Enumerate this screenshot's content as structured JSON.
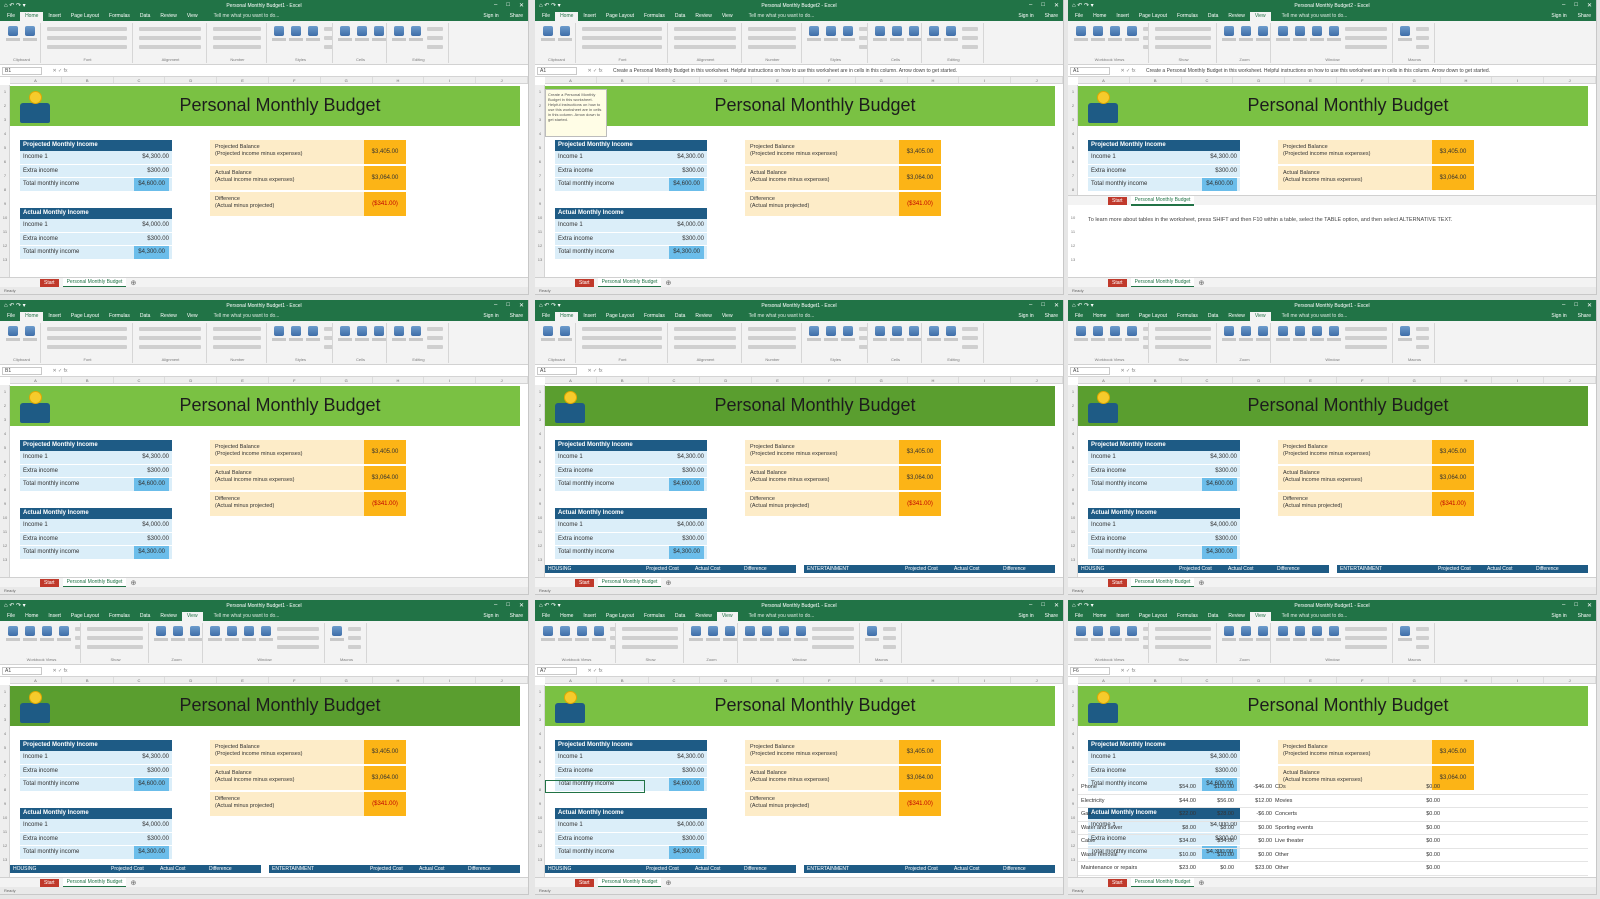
{
  "app": {
    "qat": "⌂ ↶ ↷ ▾",
    "window_controls": [
      "–",
      "□",
      "✕"
    ]
  },
  "ribbon": {
    "home_tabs": [
      "File",
      "Home",
      "Insert",
      "Page Layout",
      "Formulas",
      "Data",
      "Review",
      "View"
    ],
    "tell_me": "Tell me what you want to do...",
    "sign_in": "Sign in",
    "share": "Share",
    "home_groups": [
      {
        "name": "Clipboard",
        "icons": 2
      },
      {
        "name": "Font",
        "icons": 0
      },
      {
        "name": "Alignment",
        "icons": 0
      },
      {
        "name": "Number",
        "icons": 0
      },
      {
        "name": "Styles",
        "icons": 3
      },
      {
        "name": "Cells",
        "icons": 3
      },
      {
        "name": "Editing",
        "icons": 2
      }
    ],
    "view_groups": [
      {
        "name": "Workbook Views",
        "icons": 4
      },
      {
        "name": "Show",
        "icons": 0
      },
      {
        "name": "Zoom",
        "icons": 3
      },
      {
        "name": "Window",
        "icons": 4
      },
      {
        "name": "Macros",
        "icons": 1
      }
    ]
  },
  "formula": {
    "fx": "✕ ✓ fx",
    "instruction": "Create a Personal Monthly Budget in this worksheet. Helpful instructions on how to use this worksheet are in cells in this column. Arrow down to get started."
  },
  "budget": {
    "title": "Personal Monthly Budget",
    "projected_header": "Projected Monthly Income",
    "projected_rows": [
      {
        "label": "Income 1",
        "value": "$4,300.00"
      },
      {
        "label": "Extra income",
        "value": "$300.00"
      },
      {
        "label": "Total monthly income",
        "value": "$4,600.00"
      }
    ],
    "actual_header": "Actual Monthly Income",
    "actual_rows": [
      {
        "label": "Income 1",
        "value": "$4,000.00"
      },
      {
        "label": "Extra income",
        "value": "$300.00"
      },
      {
        "label": "Total monthly income",
        "value": "$4,300.00"
      }
    ],
    "balance": [
      {
        "label": "Projected Balance",
        "sub": "(Projected income minus expenses)",
        "value": "$3,405.00"
      },
      {
        "label": "Actual Balance",
        "sub": "(Actual income minus expenses)",
        "value": "$3,064.00"
      },
      {
        "label": "Difference",
        "sub": "(Actual minus projected)",
        "value": "($341.00)"
      }
    ],
    "housing": {
      "label": "HOUSING",
      "cols": [
        "Projected Cost",
        "Actual Cost",
        "Difference"
      ]
    },
    "entertainment": {
      "label": "ENTERTAINMENT",
      "cols": [
        "Projected Cost",
        "Actual Cost",
        "Difference"
      ]
    }
  },
  "tooltip": "Create a Personal Monthly Budget in this worksheet. Helpful instructions on how to use this worksheet are in cells in this column. Arrow down to get started.",
  "tables_note": "To learn more about tables in the worksheet, press SHIFT and then F10 within a table, select the TABLE option, and then select ALTERNATIVE TEXT.",
  "expenses": {
    "housing": [
      {
        "item": "Phone",
        "p": "$54.00",
        "a": "$100.00",
        "d": "-$46.00"
      },
      {
        "item": "Electricity",
        "p": "$44.00",
        "a": "$56.00",
        "d": "$12.00"
      },
      {
        "item": "Gas",
        "p": "$22.00",
        "a": "$28.00",
        "d": "-$6.00"
      },
      {
        "item": "Water and sewer",
        "p": "$8.00",
        "a": "$8.00",
        "d": "$0.00"
      },
      {
        "item": "Cable",
        "p": "$34.00",
        "a": "$34.00",
        "d": "$0.00"
      },
      {
        "item": "Waste removal",
        "p": "$10.00",
        "a": "$10.00",
        "d": "$0.00"
      },
      {
        "item": "Maintenance or repairs",
        "p": "$23.00",
        "a": "$0.00",
        "d": "$23.00"
      }
    ],
    "entertainment": [
      {
        "item": "CDs",
        "d": "$0.00"
      },
      {
        "item": "Movies",
        "d": "$0.00"
      },
      {
        "item": "Concerts",
        "d": "$0.00"
      },
      {
        "item": "Sporting events",
        "d": "$0.00"
      },
      {
        "item": "Live theater",
        "d": "$0.00"
      },
      {
        "item": "Other",
        "d": "$0.00"
      },
      {
        "item": "Other",
        "d": "$0.00"
      }
    ]
  },
  "sheet_tabs": {
    "start": "Start",
    "budget": "Personal Monthly Budget",
    "add": "⊕"
  },
  "status": "Ready",
  "windows": [
    {
      "title": "Personal Monthly Budget1 - Excel",
      "ribbon": "home",
      "namebox": "B1",
      "variant": "normal",
      "cols": [
        "A",
        "B",
        "C",
        "D",
        "E",
        "F",
        "G",
        "H",
        "I",
        "J"
      ]
    },
    {
      "title": "Personal Monthly Budget2 - Excel",
      "ribbon": "home",
      "namebox": "A1",
      "variant": "tooltip",
      "cols": [
        "A",
        "B",
        "C",
        "D",
        "E",
        "F",
        "G",
        "H",
        "I",
        "J"
      ]
    },
    {
      "title": "Personal Monthly Budget2 - Excel",
      "ribbon": "view",
      "namebox": "A1",
      "variant": "split",
      "cols": [
        "A",
        "B",
        "C",
        "D",
        "E",
        "F",
        "G",
        "H",
        "I",
        "J"
      ]
    },
    {
      "title": "Personal Monthly Budget1 - Excel",
      "ribbon": "home",
      "namebox": "B1",
      "variant": "normal",
      "cols": [
        "A",
        "B",
        "C",
        "D",
        "E",
        "F",
        "G",
        "H",
        "I",
        "J"
      ]
    },
    {
      "title": "Personal Monthly Budget1 - Excel",
      "ribbon": "home",
      "namebox": "A1",
      "variant": "darkcats",
      "cols": [
        "A",
        "B",
        "C",
        "D",
        "E",
        "F",
        "G",
        "H",
        "I",
        "J"
      ]
    },
    {
      "title": "Personal Monthly Budget1 - Excel",
      "ribbon": "view",
      "namebox": "A1",
      "variant": "darkcats",
      "cols": [
        "A",
        "B",
        "C",
        "D",
        "E",
        "F",
        "G",
        "H",
        "I",
        "J"
      ]
    },
    {
      "title": "Personal Monthly Budget1 - Excel",
      "ribbon": "view",
      "namebox": "A1",
      "variant": "darkcats",
      "cols": [
        "A",
        "B",
        "C",
        "D",
        "E",
        "F",
        "G",
        "H",
        "I",
        "J"
      ]
    },
    {
      "title": "Personal Monthly Budget1 - Excel",
      "ribbon": "view",
      "namebox": "A7",
      "variant": "selcats",
      "cols": [
        "A",
        "B",
        "C",
        "D",
        "E",
        "F",
        "G",
        "H",
        "I",
        "J"
      ]
    },
    {
      "title": "Personal Monthly Budget1 - Excel",
      "ribbon": "view",
      "namebox": "F6",
      "variant": "frozen",
      "cols": [
        "A",
        "B",
        "C",
        "D",
        "E",
        "F",
        "G",
        "H",
        "I",
        "J"
      ]
    }
  ]
}
